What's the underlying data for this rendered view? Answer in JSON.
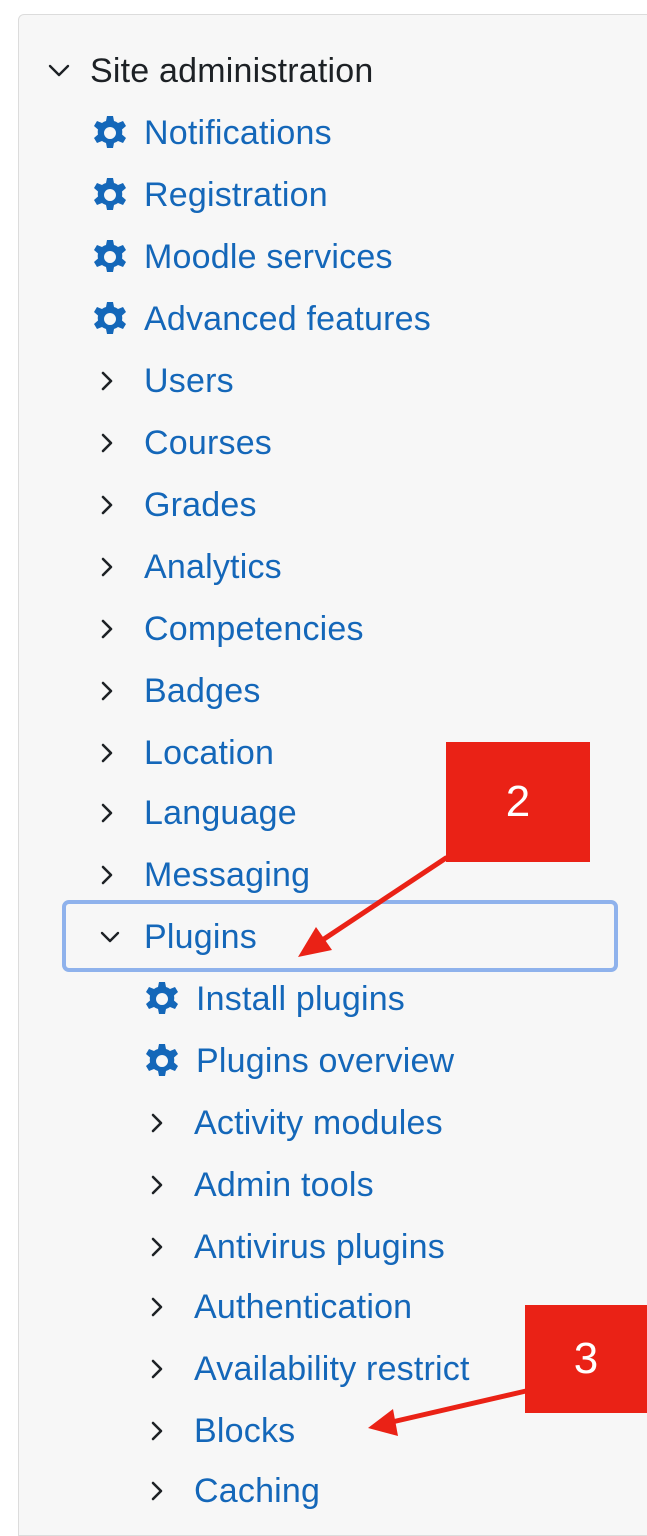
{
  "nav": {
    "root": {
      "label": "Site administration",
      "icon": "chevron-down-icon"
    },
    "items": [
      {
        "label": "Notifications",
        "icon": "gear-icon"
      },
      {
        "label": "Registration",
        "icon": "gear-icon"
      },
      {
        "label": "Moodle services",
        "icon": "gear-icon"
      },
      {
        "label": "Advanced features",
        "icon": "gear-icon"
      },
      {
        "label": "Users",
        "icon": "chevron-right-icon"
      },
      {
        "label": "Courses",
        "icon": "chevron-right-icon"
      },
      {
        "label": "Grades",
        "icon": "chevron-right-icon"
      },
      {
        "label": "Analytics",
        "icon": "chevron-right-icon"
      },
      {
        "label": "Competencies",
        "icon": "chevron-right-icon"
      },
      {
        "label": "Badges",
        "icon": "chevron-right-icon"
      },
      {
        "label": "Location",
        "icon": "chevron-right-icon"
      },
      {
        "label": "Language",
        "icon": "chevron-right-icon"
      },
      {
        "label": "Messaging",
        "icon": "chevron-right-icon"
      },
      {
        "label": "Plugins",
        "icon": "chevron-down-icon"
      }
    ],
    "plugins_children": [
      {
        "label": "Install plugins",
        "icon": "gear-icon"
      },
      {
        "label": "Plugins overview",
        "icon": "gear-icon"
      },
      {
        "label": "Activity modules",
        "icon": "chevron-right-icon"
      },
      {
        "label": "Admin tools",
        "icon": "chevron-right-icon"
      },
      {
        "label": "Antivirus plugins",
        "icon": "chevron-right-icon"
      },
      {
        "label": "Authentication",
        "icon": "chevron-right-icon"
      },
      {
        "label": "Availability restrict",
        "icon": "chevron-right-icon"
      },
      {
        "label": "Blocks",
        "icon": "chevron-right-icon"
      },
      {
        "label": "Caching",
        "icon": "chevron-right-icon"
      }
    ]
  },
  "annotations": [
    {
      "number": "2",
      "color": "#ea2216",
      "points_to": "Plugins"
    },
    {
      "number": "3",
      "color": "#ea2216",
      "points_to": "Blocks"
    }
  ],
  "colors": {
    "link": "#1467b9",
    "text": "#1d2125",
    "focus_outline": "#8fb2ec",
    "annotation": "#ea2216"
  }
}
